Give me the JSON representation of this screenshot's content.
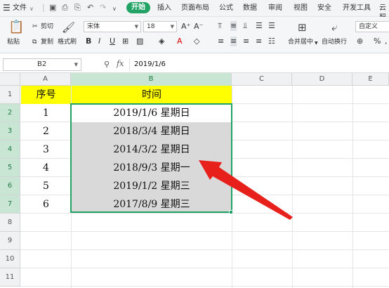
{
  "menu": {
    "file_label": "文件",
    "tabs": [
      {
        "label": "开始",
        "active": true
      },
      {
        "label": "插入"
      },
      {
        "label": "页面布局"
      },
      {
        "label": "公式"
      },
      {
        "label": "数据"
      },
      {
        "label": "审阅"
      },
      {
        "label": "视图"
      },
      {
        "label": "安全"
      },
      {
        "label": "开发工具"
      },
      {
        "label": "云服"
      }
    ]
  },
  "ribbon": {
    "paste_label": "粘贴",
    "cut_label": "剪切",
    "copy_label": "复制",
    "format_painter_label": "格式刷",
    "font_name": "宋体",
    "font_size": "18",
    "merge_center_label": "合并居中",
    "wrap_text_label": "自动换行",
    "number_format": "自定义"
  },
  "formula_bar": {
    "cell_ref": "B2",
    "fx_label": "fx",
    "value": "2019/1/6"
  },
  "columns": [
    "A",
    "B",
    "C",
    "D",
    "E"
  ],
  "rows": [
    "1",
    "2",
    "3",
    "4",
    "5",
    "6",
    "7",
    "8",
    "9",
    "10",
    "11"
  ],
  "table": {
    "header_seq": "序号",
    "header_time": "时间",
    "rows": [
      {
        "seq": "1",
        "time": "2019/1/6  星期日"
      },
      {
        "seq": "2",
        "time": "2018/3/4  星期日"
      },
      {
        "seq": "3",
        "time": "2014/3/2  星期日"
      },
      {
        "seq": "4",
        "time": "2018/9/3  星期一"
      },
      {
        "seq": "5",
        "time": "2019/1/2  星期三"
      },
      {
        "seq": "6",
        "time": "2017/8/9  星期三"
      }
    ]
  },
  "colors": {
    "accent_green": "#21a366",
    "header_yellow": "#ffff00",
    "selection_gray": "#d9d9d9",
    "arrow_red": "#e8201c"
  }
}
